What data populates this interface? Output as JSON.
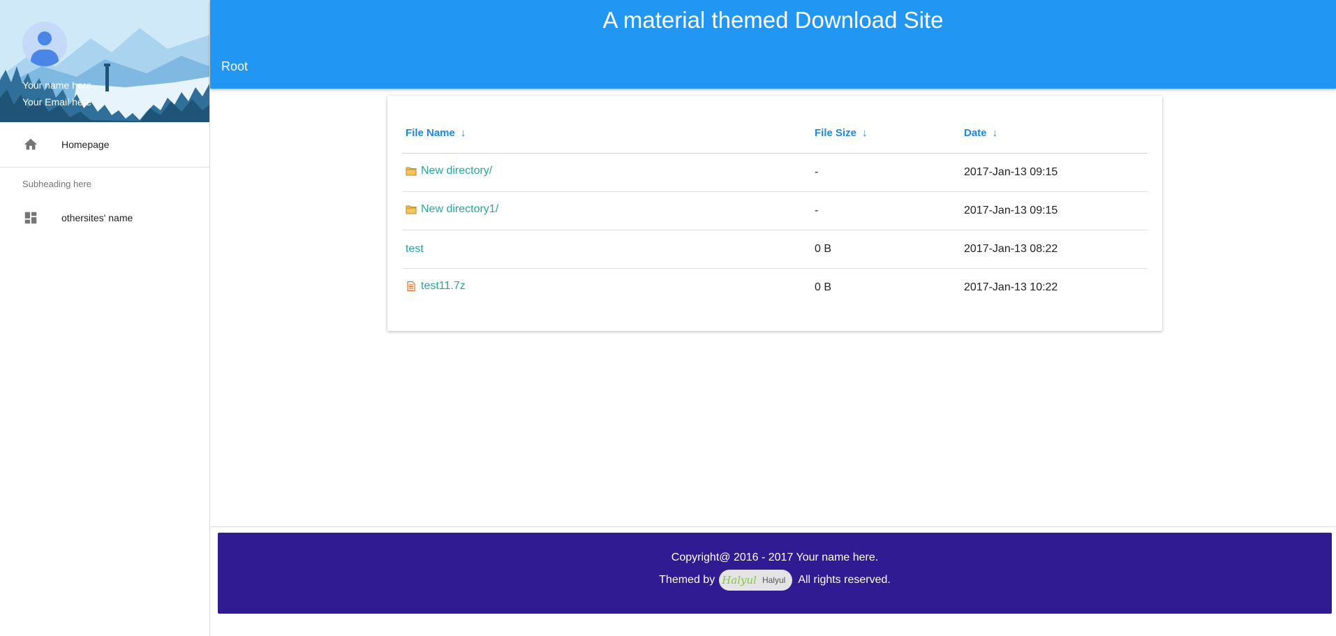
{
  "sidebar": {
    "user_name": "Your name here",
    "user_email": "Your Email here",
    "items": [
      {
        "label": "Homepage",
        "icon": "home-icon"
      },
      {
        "label": "othersites' name",
        "icon": "dashboard-icon"
      }
    ],
    "subheading": "Subheading here"
  },
  "header": {
    "title": "A material themed Download Site",
    "breadcrumb": "Root"
  },
  "table": {
    "columns": [
      {
        "label": "File Name",
        "sort": "↓"
      },
      {
        "label": "File Size",
        "sort": "↓"
      },
      {
        "label": "Date",
        "sort": "↓"
      }
    ],
    "rows": [
      {
        "name": "New directory/",
        "size": "-",
        "date": "2017-Jan-13 09:15",
        "icon": "folder-icon"
      },
      {
        "name": "New directory1/",
        "size": "-",
        "date": "2017-Jan-13 09:15",
        "icon": "folder-icon"
      },
      {
        "name": "test",
        "size": "0 B",
        "date": "2017-Jan-13 08:22",
        "icon": ""
      },
      {
        "name": "test11.7z",
        "size": "0 B",
        "date": "2017-Jan-13 10:22",
        "icon": "archive-file-icon"
      }
    ]
  },
  "footer": {
    "copyright": "Copyright@ 2016 - 2017 Your name here.",
    "themed_by": "Themed by",
    "badge_logo": "Halyul",
    "badge_text": "Halyul",
    "rights": "All rights reserved."
  },
  "colors": {
    "primary": "#2196f3",
    "footer": "#311b92",
    "link": "#26a69a",
    "header_text": "#1e88e5"
  }
}
